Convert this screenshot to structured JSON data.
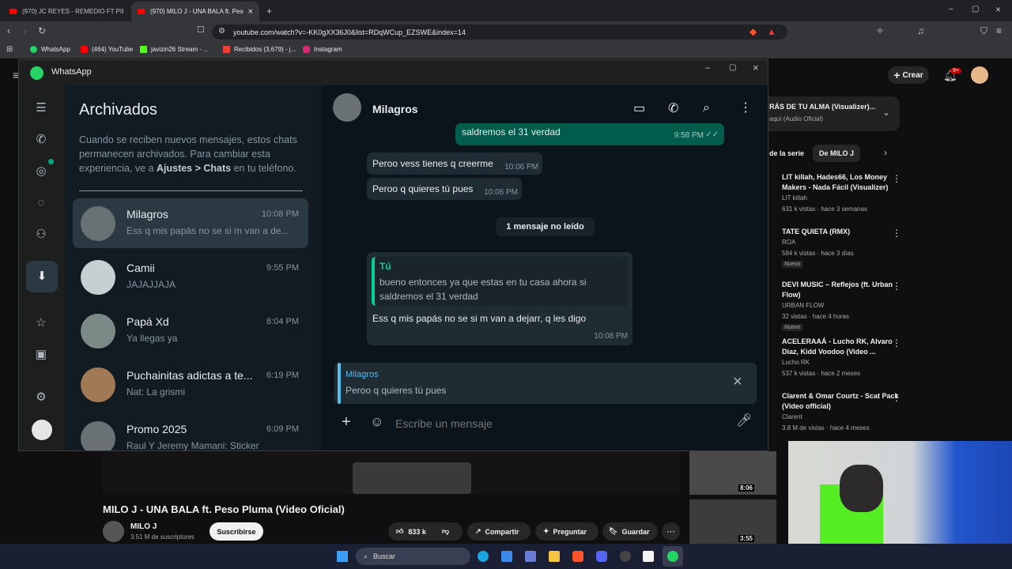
{
  "browser": {
    "tabs": [
      {
        "title": "(970) JC REYES - REMEDIO FT PIRLO"
      },
      {
        "title": "(970) MILO J - UNA BALA ft. Peso"
      }
    ],
    "url": "youtube.com/watch?v=-KK0gXX36J0&list=RDqWCup_EZSWE&index=14",
    "bookmarks": [
      "WhatsApp",
      "(464) YouTube",
      "javizin26 Stream - ...",
      "Recibidos (3,679) - j...",
      "Instagram"
    ]
  },
  "youtube": {
    "create_label": "Crear",
    "notif_count": "9+",
    "playlist": {
      "title": "RÁS DE TU ALMA (Visualizer)...",
      "subtitle": "aquí (Audio Oficial)"
    },
    "chips": [
      "de la serie",
      "De MILO J"
    ],
    "recs": [
      {
        "title": "LIT killah, Hades66, Los Money Makers - Nada Fácil (Visualizer)",
        "channel": "LIT killah",
        "meta": "631 k vistas · hace 3 semanas",
        "badge": ""
      },
      {
        "title": "TATE QUIETA (RMX)",
        "channel": "ROA",
        "meta": "584 k vistas · hace 3 días",
        "badge": "Nuevo"
      },
      {
        "title": "DEVI MUSIC – Reflejos (ft. Urban Flow)",
        "channel": "URBAN FLOW",
        "meta": "32 vistas · hace 4 horas",
        "badge": "Nuevo"
      },
      {
        "title": "ACELERAAÁ - Lucho RK, Alvaro Diaz, Kidd Voodoo (Video ...",
        "channel": "Lucho RK",
        "meta": "537 k vistas · hace 2 meses",
        "badge": ""
      },
      {
        "title": "Clarent & Omar Courtz - Scat Pack (Video official)",
        "channel": "Clarent",
        "meta": "3.8 M de vistas · hace 4 meses",
        "badge": ""
      }
    ],
    "video_title": "MILO J - UNA BALA ft. Peso Pluma (Video Oficial)",
    "channel_name": "MILO J",
    "subs": "3.51 M de suscriptores",
    "subscribe": "Suscribirse",
    "likes": "833 k",
    "share": "Compartir",
    "ask": "Preguntar",
    "save": "Guardar",
    "thumb_times": [
      "8:06",
      "3:55"
    ],
    "side_channel": "aquí (Audio Oficial)",
    "side_suscribe_count": "de vistas"
  },
  "whatsapp": {
    "app_title": "WhatsApp",
    "archived_title": "Archivados",
    "archived_info_1": "Cuando se reciben nuevos mensajes, estos chats permanecen archivados. Para cambiar esta experiencia, ve a ",
    "archived_info_bold": "Ajustes > Chats",
    "archived_info_2": " en tu teléfono.",
    "chats": [
      {
        "name": "Milagros",
        "time": "10:08 PM",
        "msg": "Ess q mis papás no se si m van a de..."
      },
      {
        "name": "Camii",
        "time": "9:55 PM",
        "msg": "JAJAJJAJA"
      },
      {
        "name": "Papá Xd",
        "time": "8:04 PM",
        "msg": "Ya llegas ya"
      },
      {
        "name": "Puchainitas adictas a te...",
        "time": "6:19 PM",
        "msg": "Nat: La grismi"
      },
      {
        "name": "Promo 2025",
        "time": "6:09 PM",
        "msg": "Raul Y Jeremy Mamani: Sticker"
      }
    ],
    "chat_header": "Milagros",
    "messages": {
      "top_out_text": "saldremos el 31 verdad",
      "top_out_time": "9:58 PM",
      "in1_text": "Peroo vess tienes q creerme",
      "in1_time": "10:06 PM",
      "in2_text": "Peroo q quieres tú pues",
      "in2_time": "10:06 PM",
      "unread": "1 mensaje no leído",
      "reply_author": "Tú",
      "reply_text": "bueno entonces ya que estas en tu casa ahora si saldremos el 31 verdad",
      "in3_text": "Ess q mis papás no se si m van a dejarr, q les digo",
      "in3_time": "10:08 PM"
    },
    "quote_author": "Milagros",
    "quote_text": "Peroo q quieres tú pues",
    "input_placeholder": "Escribe un mensaje"
  },
  "taskbar": {
    "search": "Buscar"
  },
  "colors": {
    "wa_green": "#00a884",
    "yt_red": "#ff0000",
    "bubble_out": "#005c4b"
  }
}
